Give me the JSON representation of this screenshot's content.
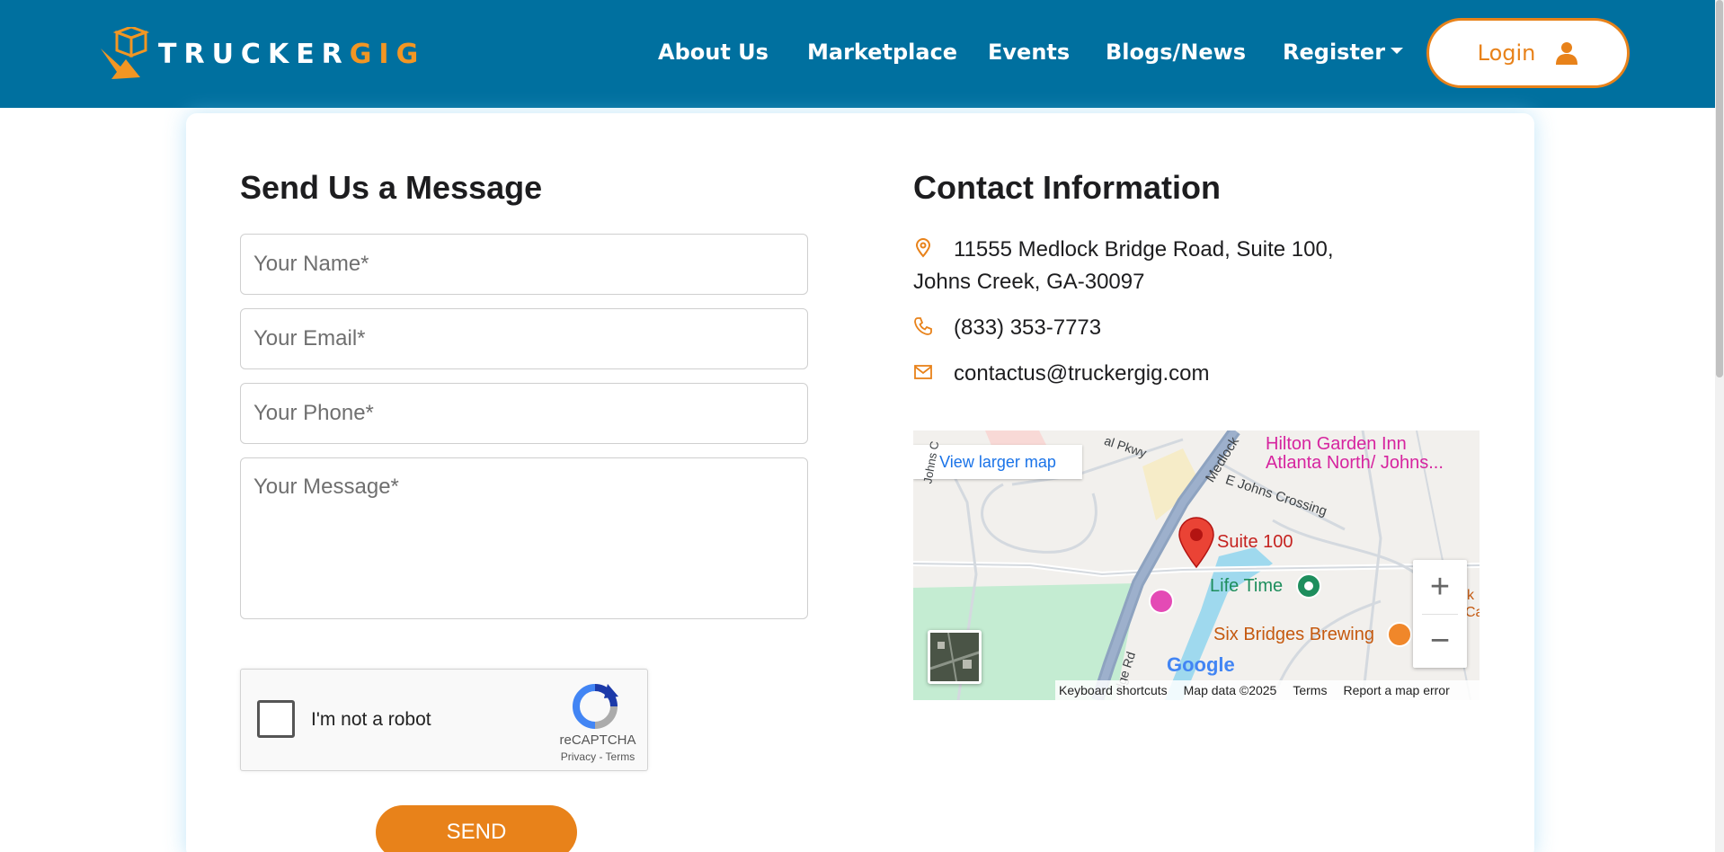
{
  "brand": {
    "name_white": "TRUCKER",
    "name_orange": "GIG"
  },
  "nav": {
    "about": "About Us",
    "marketplace": "Marketplace",
    "events": "Events",
    "blogs": "Blogs/News",
    "register": "Register",
    "login": "Login"
  },
  "form": {
    "title": "Send Us a Message",
    "name_placeholder": "Your Name*",
    "email_placeholder": "Your Email*",
    "phone_placeholder": "Your Phone*",
    "message_placeholder": "Your Message*",
    "captcha_label": "I'm not a robot",
    "captcha_brand": "reCAPTCHA",
    "captcha_links": "Privacy - Terms",
    "send_label": "SEND"
  },
  "contact": {
    "title": "Contact Information",
    "address_line1": "11555 Medlock Bridge Road, Suite 100,",
    "address_line2": "Johns Creek, GA-30097",
    "phone": "(833) 353-7773",
    "email": "contactus@truckergig.com"
  },
  "map": {
    "view_larger": "View larger map",
    "pin_label": "Suite 100",
    "hotel_label_1": "Hilton Garden Inn",
    "hotel_label_2": "Atlanta North/ Johns...",
    "gym_label": "Life Time",
    "brewery_label": "Six Bridges Brewing",
    "road_parkway": "al Pkwy",
    "road_medlock": "Medlock",
    "road_crossing": "E Johns Crossing",
    "road_bridge": "dge Rd",
    "road_johns": "Johns C",
    "edge_label_1": "k",
    "edge_label_2": "Ca",
    "google": "Google",
    "footer_shortcuts": "Keyboard shortcuts",
    "footer_data": "Map data ©2025",
    "footer_terms": "Terms",
    "footer_report": "Report a map error"
  },
  "colors": {
    "header_bg": "#00709f",
    "accent_orange": "#e8821a",
    "link_blue": "#1a73e8"
  }
}
